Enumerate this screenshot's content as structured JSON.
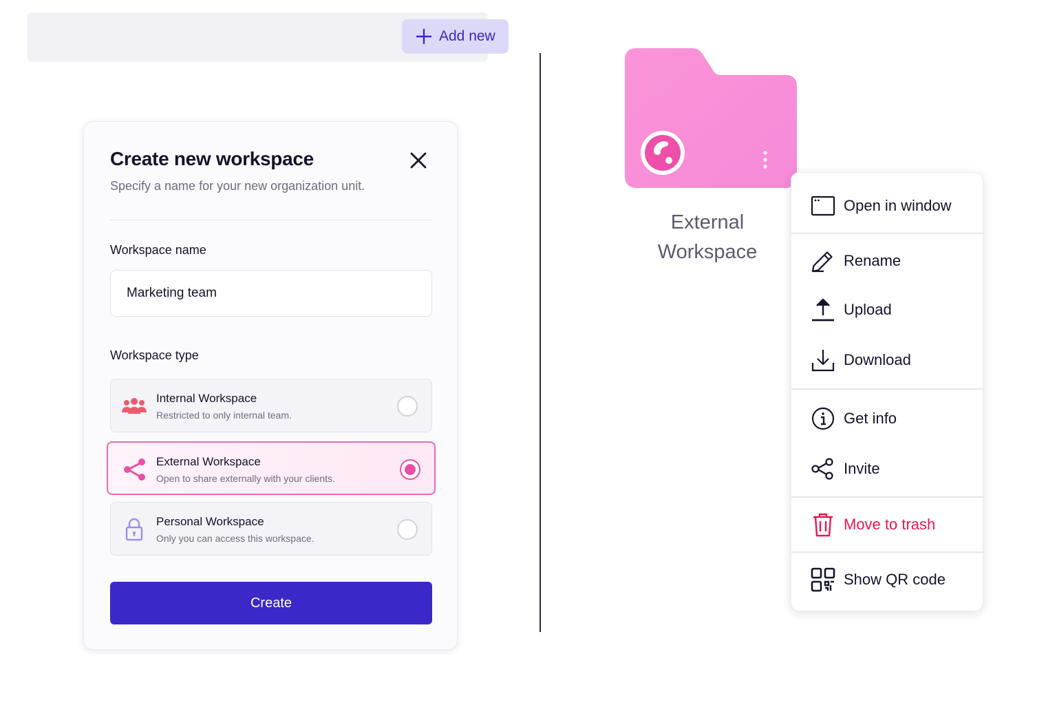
{
  "toolbar": {
    "add_new_label": "Add new"
  },
  "modal": {
    "title": "Create new workspace",
    "subtitle": "Specify a name for your new organization unit.",
    "name_label": "Workspace name",
    "name_value": "Marketing team",
    "type_label": "Workspace type",
    "options": [
      {
        "title": "Internal Workspace",
        "description": "Restricted to only internal team.",
        "icon": "team-icon",
        "selected": false
      },
      {
        "title": "External Workspace",
        "description": "Open to share externally with your clients.",
        "icon": "share-icon",
        "selected": true
      },
      {
        "title": "Personal Workspace",
        "description": "Only you can access this workspace.",
        "icon": "lock-icon",
        "selected": false
      }
    ],
    "create_label": "Create"
  },
  "folder": {
    "name": "External Workspace",
    "icon": "folder-icon",
    "color": "#f78ad6"
  },
  "context_menu": {
    "items": [
      {
        "label": "Open in window",
        "icon": "window-icon"
      },
      {
        "label": "Rename",
        "icon": "pencil-icon"
      },
      {
        "label": "Upload",
        "icon": "upload-icon"
      },
      {
        "label": "Download",
        "icon": "download-icon"
      },
      {
        "label": "Get info",
        "icon": "info-icon"
      },
      {
        "label": "Invite",
        "icon": "share-icon"
      },
      {
        "label": "Move to trash",
        "icon": "trash-icon",
        "danger": true
      },
      {
        "label": "Show QR code",
        "icon": "qr-code-icon"
      }
    ]
  },
  "colors": {
    "primary": "#3b28c9",
    "accent_pink": "#ec4fa5",
    "danger": "#e8174f",
    "add_button_bg": "#dcd9f8"
  }
}
